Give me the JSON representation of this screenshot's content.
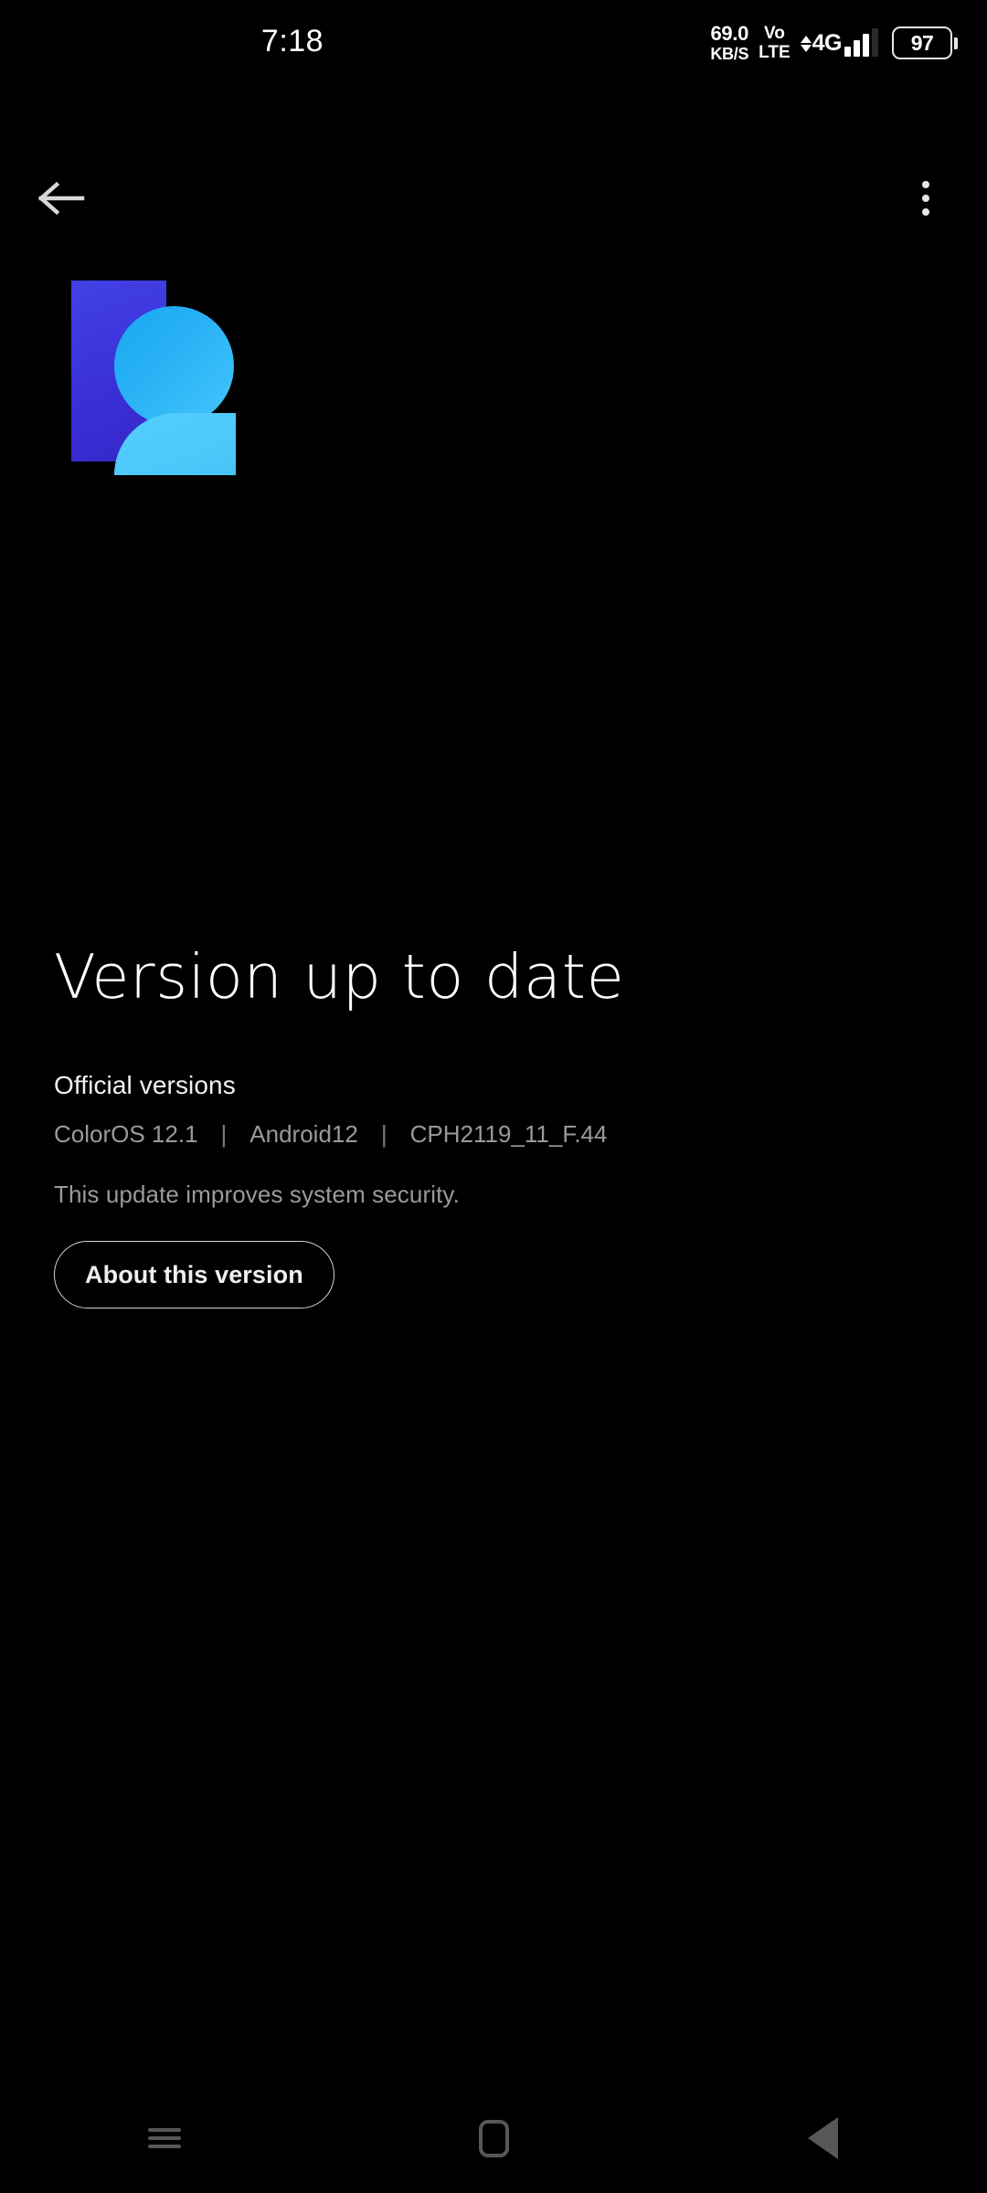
{
  "status_bar": {
    "time": "7:18",
    "network_speed_value": "69.0",
    "network_speed_unit": "KB/S",
    "volte_top": "Vo",
    "volte_bottom": "LTE",
    "network_type": "4G",
    "battery_percent": "97",
    "icons": {
      "data_arrows": "data-transfer-arrows-icon",
      "signal": "signal-bars-icon",
      "battery": "battery-icon"
    }
  },
  "app_bar": {
    "back_icon": "back-arrow-icon",
    "overflow_icon": "overflow-menu-icon"
  },
  "illustration": {
    "name": "system-update-illustration",
    "rect_color": "#3a30d8",
    "circle_color": "#29b2f5",
    "halfround_color": "#4ec9fa"
  },
  "main": {
    "headline": "Version up to date",
    "section_title": "Official versions",
    "version_parts": [
      "ColorOS 12.1",
      "Android12",
      "CPH2119_11_F.44"
    ],
    "separator": "|",
    "update_description": "This update improves system security.",
    "about_button_label": "About this version"
  },
  "nav_bar": {
    "recents_icon": "recents-menu-icon",
    "home_icon": "home-square-icon",
    "back_icon": "back-triangle-icon"
  },
  "colors": {
    "background": "#000000",
    "primary_text": "#ffffff",
    "secondary_text": "#9a9a9a",
    "nav_icon": "#575757"
  }
}
